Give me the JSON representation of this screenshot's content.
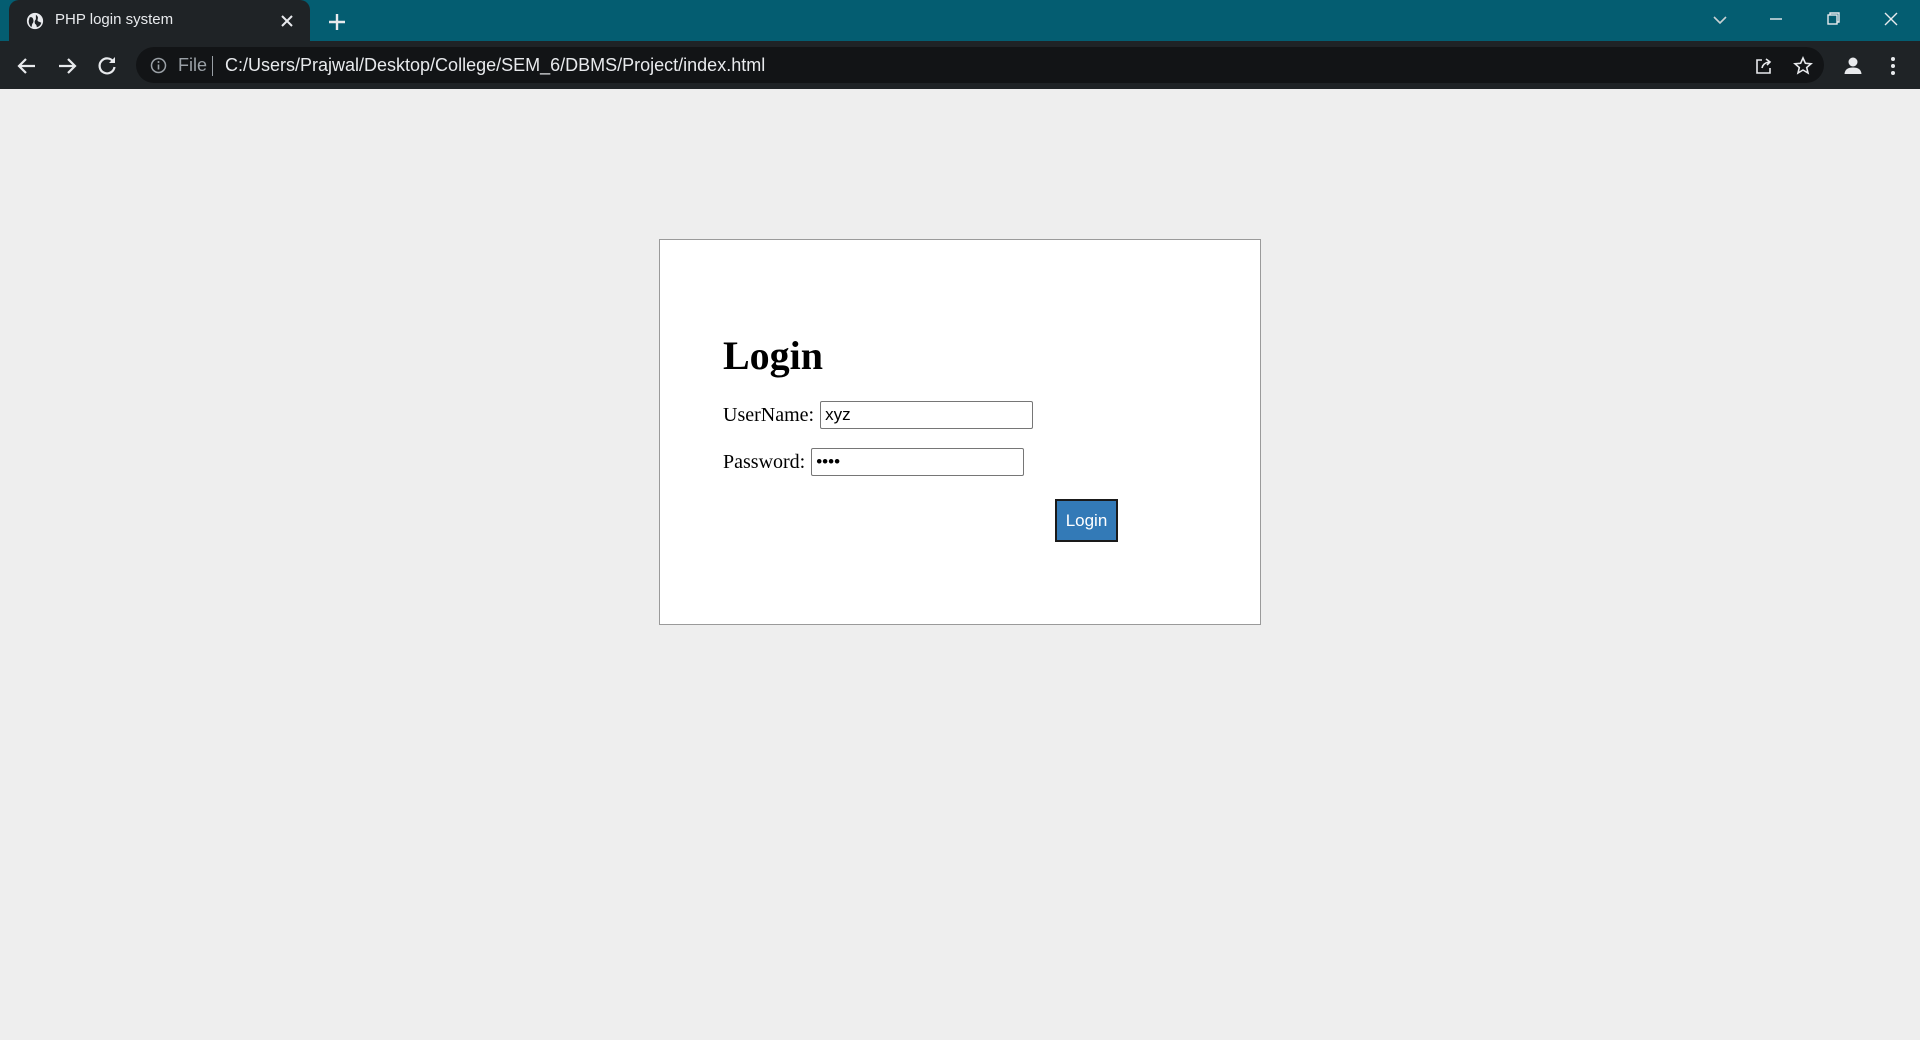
{
  "browser": {
    "tab_title": "PHP login system",
    "file_label": "File",
    "url": "C:/Users/Prajwal/Desktop/College/SEM_6/DBMS/Project/index.html",
    "colors": {
      "tabstrip": "#045d71",
      "toolbar": "#1f2326",
      "omnibox": "#121416"
    }
  },
  "page": {
    "heading": "Login",
    "username_label": "UserName:",
    "username_value": "xyz",
    "password_label": "Password:",
    "password_value": "abcd",
    "login_button": "Login",
    "colors": {
      "background": "#eeeeee",
      "button": "#337ab7"
    }
  }
}
